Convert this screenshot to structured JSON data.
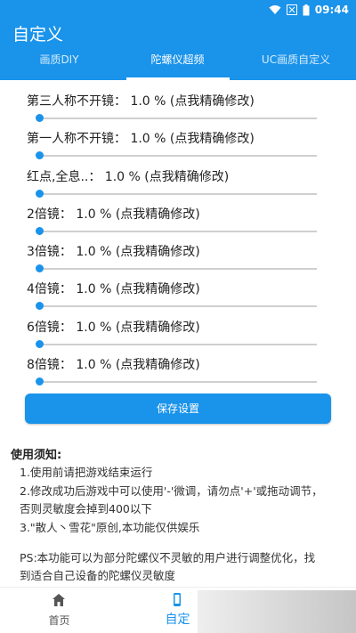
{
  "status": {
    "time": "09:44"
  },
  "app": {
    "title": "自定义"
  },
  "tabs": [
    {
      "label": "画质DIY"
    },
    {
      "label": "陀螺仪超频"
    },
    {
      "label": "UC画质自定义"
    }
  ],
  "settings": [
    {
      "label": "第三人称不开镜： 1.0 % (点我精确修改)",
      "value": 1.0
    },
    {
      "label": "第一人称不开镜： 1.0 % (点我精确修改)",
      "value": 1.0
    },
    {
      "label": "红点,全息..： 1.0 % (点我精确修改)",
      "value": 1.0
    },
    {
      "label": "2倍镜： 1.0 % (点我精确修改)",
      "value": 1.0
    },
    {
      "label": "3倍镜： 1.0 % (点我精确修改)",
      "value": 1.0
    },
    {
      "label": "4倍镜： 1.0 % (点我精确修改)",
      "value": 1.0
    },
    {
      "label": "6倍镜： 1.0 % (点我精确修改)",
      "value": 1.0
    },
    {
      "label": "8倍镜： 1.0 % (点我精确修改)",
      "value": 1.0
    }
  ],
  "save_button": "保存设置",
  "notes": {
    "title": "使用须知:",
    "lines": [
      "1.使用前请把游戏结束运行",
      "2.修改成功后游戏中可以使用'-'微调，请勿点'+'或拖动调节，",
      "否则灵敏度会掉到400以下",
      "3.\"散人丶雪花\"原创,本功能仅供娱乐",
      "PS:本功能可以为部分陀螺仪不灵敏的用户进行调整优化，找",
      "到适合自己设备的陀螺仪灵敏度"
    ]
  },
  "bottom_nav": [
    {
      "label": "首页",
      "icon": "home-icon"
    },
    {
      "label": "自定",
      "icon": "phone-icon"
    }
  ],
  "colors": {
    "primary": "#1a93ea",
    "track": "#cfcfcf"
  }
}
